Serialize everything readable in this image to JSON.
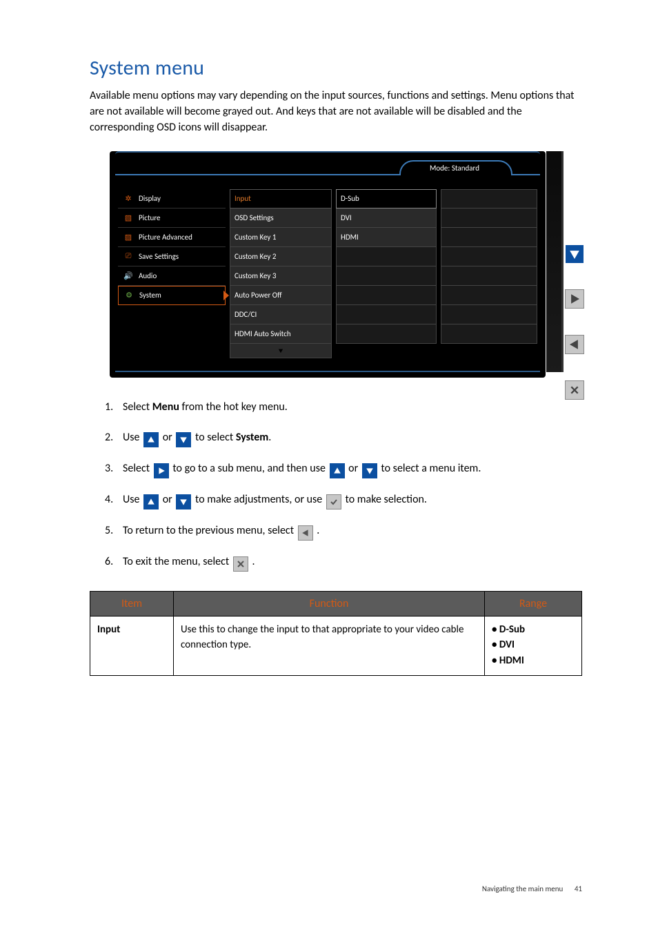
{
  "title": "System menu",
  "intro": "Available menu options may vary depending on the input sources, functions and settings. Menu options that are not available will become grayed out. And keys that are not available will be disabled and the corresponding OSD icons will disappear.",
  "osd": {
    "mode_label": "Mode: Standard",
    "left_menu": [
      {
        "label": "Display"
      },
      {
        "label": "Picture"
      },
      {
        "label": "Picture Advanced"
      },
      {
        "label": "Save Settings"
      },
      {
        "label": "Audio"
      },
      {
        "label": "System",
        "active": true
      }
    ],
    "mid_menu": [
      {
        "label": "Input",
        "highlight": true
      },
      {
        "label": "OSD Settings"
      },
      {
        "label": "Custom Key 1"
      },
      {
        "label": "Custom Key 2"
      },
      {
        "label": "Custom Key 3"
      },
      {
        "label": "Auto Power Off"
      },
      {
        "label": "DDC/CI"
      },
      {
        "label": "HDMI Auto Switch"
      }
    ],
    "right_menu": [
      {
        "label": "D-Sub",
        "outlined": true
      },
      {
        "label": "DVI"
      },
      {
        "label": "HDMI"
      }
    ]
  },
  "steps": {
    "s1a": "Select ",
    "s1b": "Menu",
    "s1c": " from the hot key menu.",
    "s2a": "Use ",
    "s2b": " or ",
    "s2c": " to select ",
    "s2d": "System",
    "s2e": ".",
    "s3a": "Select ",
    "s3b": " to go to a sub menu, and then use ",
    "s3c": " or ",
    "s3d": " to select a menu item.",
    "s4a": "Use ",
    "s4b": " or ",
    "s4c": " to make adjustments, or use ",
    "s4d": " to make selection.",
    "s5a": "To return to the previous menu, select ",
    "s5b": ".",
    "s6a": "To exit the menu, select ",
    "s6b": "."
  },
  "table": {
    "headers": {
      "item": "Item",
      "function": "Function",
      "range": "Range"
    },
    "row1": {
      "item": "Input",
      "function": "Use this to change the input to that appropriate to your video cable connection type.",
      "range": [
        "• D-Sub",
        "• DVI",
        "• HDMI"
      ]
    }
  },
  "footer": {
    "text": "Navigating the main menu",
    "page": "41"
  }
}
